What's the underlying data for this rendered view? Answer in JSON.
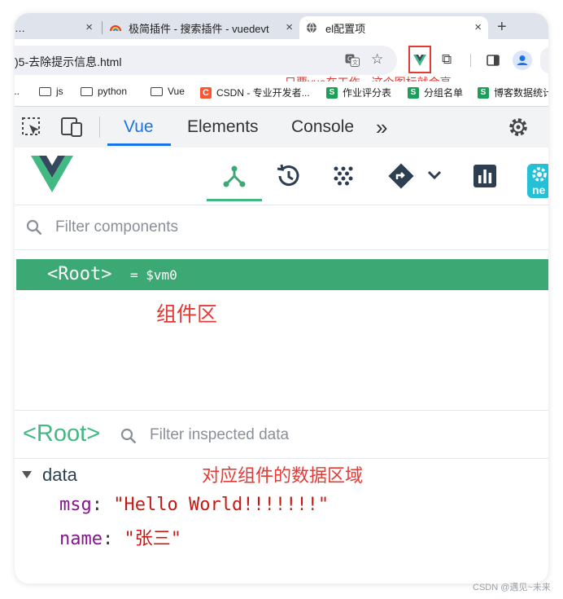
{
  "browser": {
    "tabs": [
      {
        "title": "…",
        "favicon": "page-icon",
        "active": false
      },
      {
        "title": "极简插件 - 搜索插件 - vuedevt",
        "favicon": "rainbow-logo",
        "active": false
      },
      {
        "title": "el配置项",
        "favicon": "globe-icon",
        "active": true
      }
    ],
    "tab_close": "×",
    "new_tab": "+",
    "url": ")5-去除提示信息.html",
    "toolbar_icons": [
      "translate-icon",
      "star-icon",
      "vue-extension-icon",
      "puzzle-icon",
      "sidepanel-icon",
      "profile-icon"
    ],
    "bookmarks": [
      {
        "label": "...",
        "icon": "none"
      },
      {
        "label": "js",
        "icon": "folder-icon"
      },
      {
        "label": "python",
        "icon": "folder-icon"
      },
      {
        "label": "Vue",
        "icon": "folder-icon"
      },
      {
        "label": "CSDN - 专业开发者...",
        "icon": "csdn-logo"
      },
      {
        "label": "作业评分表",
        "icon": "sheet-icon"
      },
      {
        "label": "分组名单",
        "icon": "sheet-icon"
      },
      {
        "label": "博客数据统计",
        "icon": "sheet-icon"
      }
    ]
  },
  "annotations": {
    "extension_note": "只要vue在工作，这个图标就会亮",
    "component_area": "组件区",
    "data_area": "对应组件的数据区域"
  },
  "devtools": {
    "tabs": [
      "Vue",
      "Elements",
      "Console"
    ],
    "active_tab": "Vue",
    "more": "»"
  },
  "vue_toolbar": {
    "icons": [
      "components-tree-icon",
      "timeline-icon",
      "plugins-icon",
      "routes-icon",
      "chevron-down-icon",
      "performance-icon",
      "settings-new-icon"
    ],
    "badge_text": "ne"
  },
  "components": {
    "filter_placeholder": "Filter components",
    "root_tag": "<Root>",
    "root_ref": "= $vm0"
  },
  "inspector": {
    "title": "<Root>",
    "filter_placeholder": "Filter inspected data",
    "section": "data",
    "props": [
      {
        "key": "msg",
        "value": "\"Hello World!!!!!!!\""
      },
      {
        "key": "name",
        "value": "\"张三\""
      }
    ]
  },
  "watermark": "CSDN @遇见~未来",
  "colors": {
    "vue_green": "#42b883",
    "selection_green": "#3ca874",
    "annotation_red": "#e53935",
    "devtools_blue": "#1a73e8"
  }
}
